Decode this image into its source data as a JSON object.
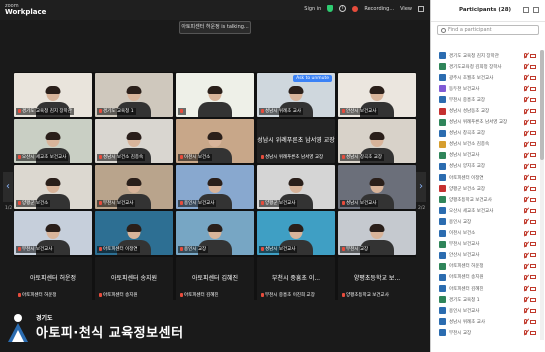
{
  "app": {
    "logo_line1": "zoom",
    "logo_line2": "Workplace"
  },
  "topbar": {
    "signin": "Sign in",
    "recording": "Recording...",
    "view": "View"
  },
  "talking_banner": "아토피센터 허운정 is talking...",
  "unmute_button": "Ask to unmute",
  "gallery": {
    "tiles": [
      {
        "name": "경기도 교육청 김지 장학관",
        "bg": "#e9e4dc"
      },
      {
        "name": "경기도 교육청 1",
        "bg": "#cfc8bd"
      },
      {
        "name": "",
        "bg": "#eef0e8"
      },
      {
        "name": "성남시 위례초 교사",
        "bg": "#cfd7dd"
      },
      {
        "name": "안산시 보건교사",
        "bg": "#ebe6df"
      },
      {
        "name": "오산시 세교초 보건교사",
        "bg": "#c9cfc4"
      },
      {
        "name": "성남시 보건소 김종숙",
        "bg": "#d9d6d0"
      },
      {
        "name": "이천시 보건소",
        "bg": "#c8a789"
      },
      {
        "name": "성남시 위례푸른초 남서영 교장",
        "bg": "#232323"
      },
      {
        "name": "성남시 창곡초 교장",
        "bg": "#d8d2c9"
      },
      {
        "name": "양평군 보건소",
        "bg": "#dcd8d0"
      },
      {
        "name": "부천시 보건교사",
        "bg": "#b9a48c"
      },
      {
        "name": "용인시 보건교사",
        "bg": "#88a8cf"
      },
      {
        "name": "양평군 보건교사",
        "bg": "#d5d5d5"
      },
      {
        "name": "성남시 보건교사",
        "bg": "#6b6f7a"
      },
      {
        "name": "부천시 보건교사",
        "bg": "#c6cfdb"
      },
      {
        "name": "아토피센터 이정연",
        "bg": "#2d6f93"
      },
      {
        "name": "용인시 교장",
        "bg": "#77a6c4"
      },
      {
        "name": "성남시 보건교사",
        "bg": "#3f9fc4"
      },
      {
        "name": "부천시 교장",
        "bg": "#c5c9cf"
      }
    ],
    "bottom_row": [
      {
        "big": "아토피센터 허운정",
        "name": "아토피센터 허운정"
      },
      {
        "big": "아토피센터 송지원",
        "name": "아토피센터 송지원"
      },
      {
        "big": "아토피센터 김혜진",
        "name": "아토피센터 김혜진"
      },
      {
        "big": "부천시 중흥초 이...",
        "name": "부천시 중흥초 이진희 교장"
      },
      {
        "big": "양평초등학교 보...",
        "name": "양평초등학교 보건교사"
      }
    ],
    "page_left": "1/2",
    "page_right": "2/2"
  },
  "brand": {
    "small": "경기도",
    "main": "아토피·천식 교육정보센터"
  },
  "participants": {
    "title": "Participants (28)",
    "search_placeholder": "Find a participant",
    "rows": [
      {
        "name": "경기도 교육청 김지 장학관",
        "color": "#2b6cb0"
      },
      {
        "name": "경기도교육청 김희정 장학사",
        "color": "#2f855a"
      },
      {
        "name": "광주시 초월초 보건교사",
        "color": "#2b6cb0"
      },
      {
        "name": "동두천 보건교사",
        "color": "#805ad5"
      },
      {
        "name": "부천시 중흥초 교장",
        "color": "#2b6cb0"
      },
      {
        "name": "성남시 성남동초 교장",
        "color": "#c53030"
      },
      {
        "name": "성남시 위례푸른초 남서영 교장",
        "color": "#2f855a"
      },
      {
        "name": "성남시 창곡초 교장",
        "color": "#2b6cb0"
      },
      {
        "name": "성남시 보건소 김종숙",
        "color": "#d69e2e"
      },
      {
        "name": "성남시 보건교사",
        "color": "#2f855a"
      },
      {
        "name": "성남시 양지초 교장",
        "color": "#2b6cb0"
      },
      {
        "name": "아토피센터 이정연",
        "color": "#2b6cb0"
      },
      {
        "name": "양평군 보건소 교장",
        "color": "#c53030"
      },
      {
        "name": "양평초등학교 보건교사",
        "color": "#2f855a"
      },
      {
        "name": "오산시 세교초 보건교사",
        "color": "#2b6cb0"
      },
      {
        "name": "용인시 교장",
        "color": "#2b6cb0"
      },
      {
        "name": "이천시 보건소",
        "color": "#2b6cb0"
      },
      {
        "name": "부천시 보건교사",
        "color": "#2f855a"
      },
      {
        "name": "안산시 보건교사",
        "color": "#2b6cb0"
      },
      {
        "name": "아토피센터 허운정",
        "color": "#2f855a"
      },
      {
        "name": "아토피센터 송지원",
        "color": "#2b6cb0"
      },
      {
        "name": "아토피센터 김혜진",
        "color": "#2b6cb0"
      },
      {
        "name": "경기도 교육청 1",
        "color": "#2f855a"
      },
      {
        "name": "용인시 보건교사",
        "color": "#2b6cb0"
      },
      {
        "name": "성남시 위례초 교사",
        "color": "#2b6cb0"
      },
      {
        "name": "부천시 교장",
        "color": "#2b6cb0"
      }
    ]
  }
}
